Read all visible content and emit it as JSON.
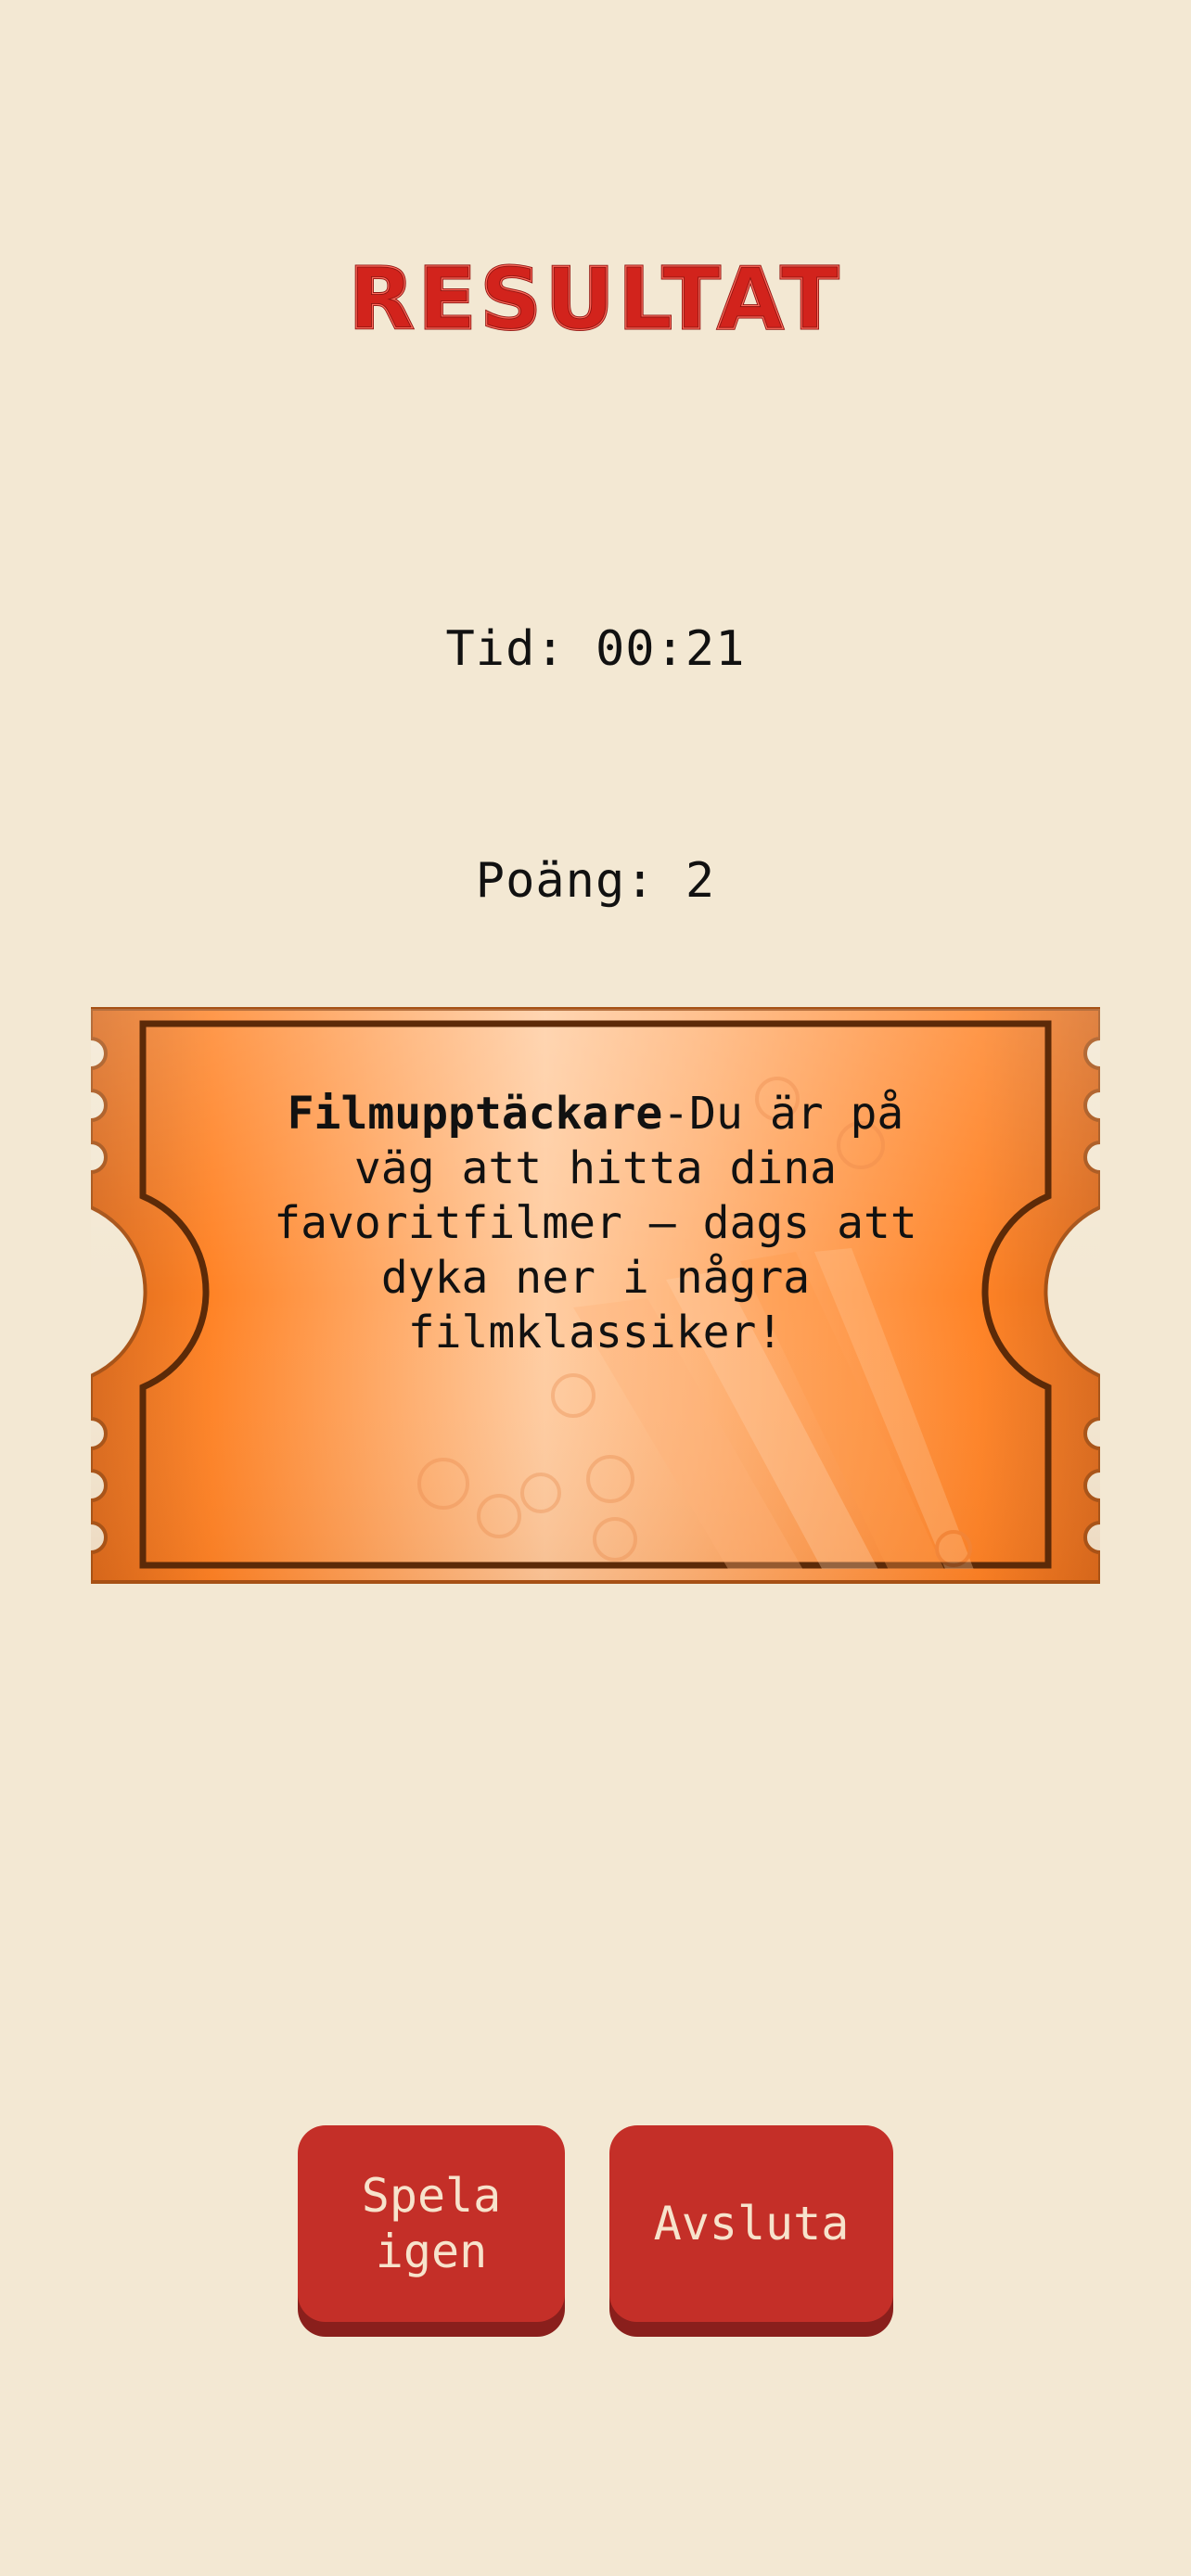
{
  "screen": {
    "title": "RESULTAT"
  },
  "stats": {
    "time": "Tid: 00:21",
    "score": "Poäng: 2"
  },
  "ticket": {
    "rank": "Filmupptäckare",
    "message": "-Du är på väg att hitta dina favoritfilmer – dags att dyka ner i några filmklassiker!"
  },
  "actions": {
    "replay_label": "Spela igen",
    "exit_label": "Avsluta"
  },
  "colors": {
    "background": "#f3e8d3",
    "title_red": "#d2231c",
    "ticket_orange": "#f4862b",
    "button_red": "#c42f28",
    "button_shadow": "#8a1f1c",
    "button_text": "#f7e3cc"
  },
  "icons": {
    "ticket_decoration": "popcorn-icon"
  }
}
